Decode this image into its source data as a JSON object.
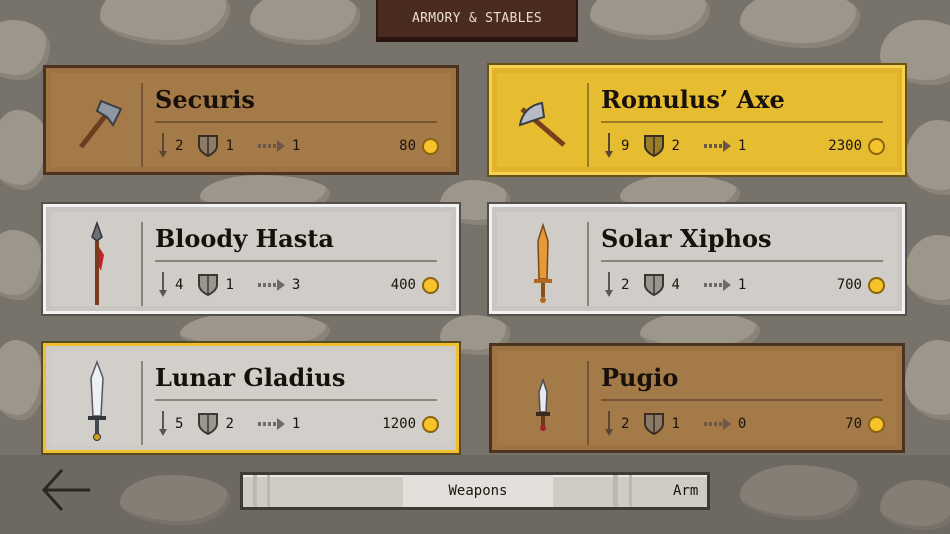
{
  "header": {
    "title": "ARMORY & STABLES"
  },
  "items": [
    {
      "name": "Securis",
      "icon": "hatchet-icon",
      "tier": "bronze",
      "attack": "2",
      "defense": "1",
      "range": "1",
      "price": "80"
    },
    {
      "name": "Romulus’ Axe",
      "icon": "battle-axe-icon",
      "tier": "gold",
      "attack": "9",
      "defense": "2",
      "range": "1",
      "price": "2300"
    },
    {
      "name": "Bloody Hasta",
      "icon": "spear-icon",
      "tier": "silver",
      "attack": "4",
      "defense": "1",
      "range": "3",
      "price": "400"
    },
    {
      "name": "Solar Xiphos",
      "icon": "bronze-sword-icon",
      "tier": "silver",
      "attack": "2",
      "defense": "4",
      "range": "1",
      "price": "700"
    },
    {
      "name": "Lunar Gladius",
      "icon": "gladius-icon",
      "tier": "silver-gold",
      "attack": "5",
      "defense": "2",
      "range": "1",
      "price": "1200"
    },
    {
      "name": "Pugio",
      "icon": "dagger-icon",
      "tier": "bronze",
      "attack": "2",
      "defense": "1",
      "range": "0",
      "price": "70"
    }
  ],
  "colors": {
    "bronze": "#9e7444",
    "gold": "#e0b52a",
    "silver": "#c9c6c2",
    "coin": "#f6c32a"
  },
  "tabs": [
    {
      "label": "Weapons",
      "selected": true
    },
    {
      "label": "Arm",
      "selected": false
    }
  ],
  "nav": {
    "back_icon": "back-arrow-icon"
  }
}
